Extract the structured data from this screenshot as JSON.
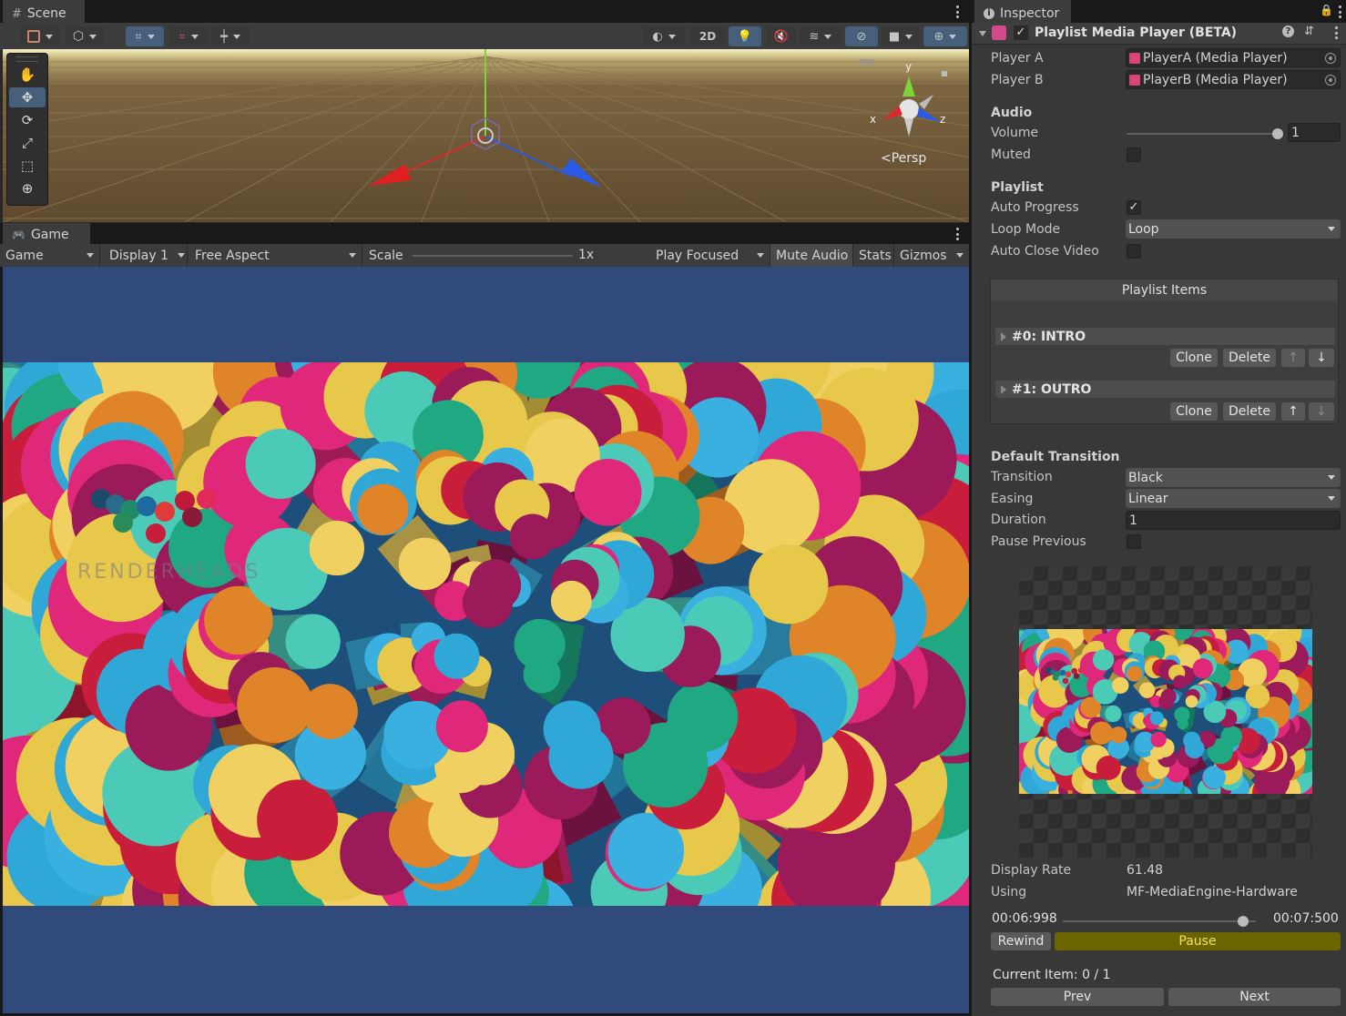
{
  "scene": {
    "tab_label": "Scene",
    "toolbar": {
      "btn_2d": "2D"
    },
    "gizmo": {
      "x": "x",
      "y": "y",
      "z": "z",
      "persp": "Persp"
    }
  },
  "game": {
    "tab_label": "Game",
    "toolbar": {
      "view_select": "Game",
      "display": "Display 1",
      "aspect": "Free Aspect",
      "scale_label": "Scale",
      "scale_value": "1x",
      "play_mode": "Play Focused",
      "mute_audio": "Mute Audio",
      "stats": "Stats",
      "gizmos": "Gizmos"
    },
    "video_watermark": "RENDERHEADS"
  },
  "inspector": {
    "tab_label": "Inspector",
    "component_title": "Playlist Media Player (BETA)",
    "player_a_label": "Player A",
    "player_a_value": "PlayerA (Media Player)",
    "player_b_label": "Player B",
    "player_b_value": "PlayerB (Media Player)",
    "audio": {
      "section": "Audio",
      "volume_label": "Volume",
      "volume_value": "1",
      "volume_level": 1.0,
      "muted_label": "Muted",
      "muted": false
    },
    "playlist": {
      "section": "Playlist",
      "auto_progress_label": "Auto Progress",
      "auto_progress": true,
      "loop_mode_label": "Loop Mode",
      "loop_mode_value": "Loop",
      "auto_close_label": "Auto Close Video",
      "auto_close": false,
      "items_header": "Playlist Items",
      "items": [
        {
          "title": "#0: INTRO",
          "clone": "Clone",
          "delete": "Delete"
        },
        {
          "title": "#1: OUTRO",
          "clone": "Clone",
          "delete": "Delete"
        }
      ]
    },
    "transition": {
      "section": "Default Transition",
      "transition_label": "Transition",
      "transition_value": "Black",
      "easing_label": "Easing",
      "easing_value": "Linear",
      "duration_label": "Duration",
      "duration_value": "1",
      "pause_previous_label": "Pause Previous",
      "pause_previous": false
    },
    "stats": {
      "display_rate_label": "Display Rate",
      "display_rate_value": "61.48",
      "using_label": "Using",
      "using_value": "MF-MediaEngine-Hardware"
    },
    "playback": {
      "current_time": "00:06:998",
      "total_time": "00:07:500",
      "progress": 0.933,
      "rewind": "Rewind",
      "pause": "Pause",
      "current_item": "Current Item: 0 / 1",
      "prev": "Prev",
      "next": "Next"
    }
  },
  "colors": {
    "editor_bg": "#383838",
    "accent_blue": "#46607c",
    "pause_yellow": "#6b6400",
    "game_bg": "#304b7b"
  }
}
